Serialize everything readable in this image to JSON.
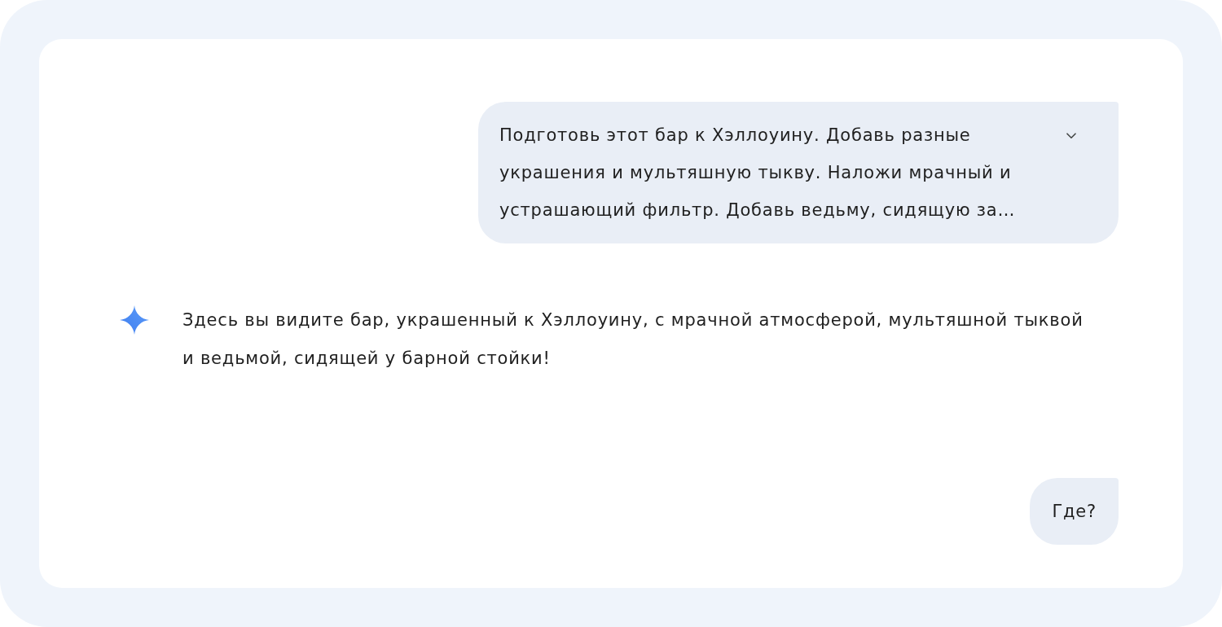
{
  "conversation": [
    {
      "kind": "user",
      "text": "Подготовь этот бар к Хэллоуину. Добавь разные украшения и мультяшную тыкву. Наложи мрачный и устрашающий фильтр. Добавь ведьму, сидящую за…",
      "expandable": true
    },
    {
      "kind": "model",
      "text": "Здесь вы видите бар, украшенный к Хэллоуину, с мрачной атмосферой, мультяшной тыквой и ведьмой, сидящей у барной стойки!"
    },
    {
      "kind": "user",
      "text": "Где?",
      "expandable": false
    }
  ]
}
